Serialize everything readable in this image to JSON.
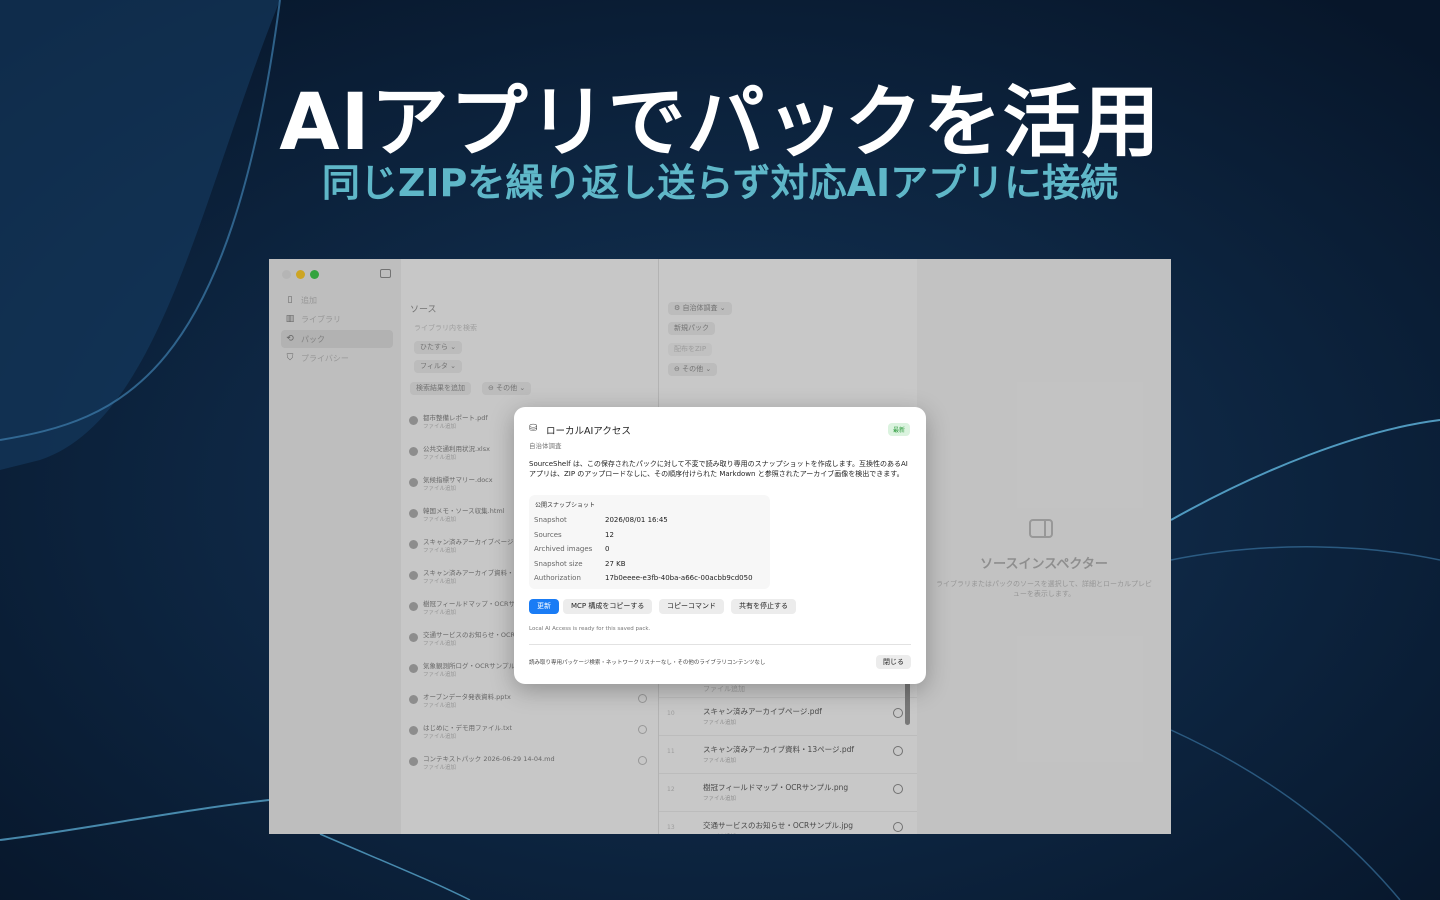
{
  "hero": {
    "title": "AIアプリでパックを活用",
    "subtitle": "同じZIPを繰り返し送らず対応AIアプリに接続"
  },
  "colors": {
    "accent": "#1a7cf5",
    "subtitle": "#5fb7c8",
    "badge": "#2a9a3a"
  },
  "sidebar": {
    "items": [
      {
        "label": "追加",
        "icon": "doc-icon"
      },
      {
        "label": "ライブラリ",
        "icon": "library-icon"
      },
      {
        "label": "パック",
        "icon": "pack-icon"
      },
      {
        "label": "プライバシー",
        "icon": "shield-icon"
      }
    ]
  },
  "sources": {
    "title": "ソース",
    "search_placeholder": "ライブラリ内を検索",
    "filter_order": "ひたすら",
    "filter": "フィルタ",
    "add_results": "検索結果を追加",
    "other": "その他",
    "files": [
      {
        "name": "都市整備レポート.pdf",
        "sub": "ファイル追加"
      },
      {
        "name": "公共交通利用状況.xlsx",
        "sub": "ファイル追加"
      },
      {
        "name": "気候指標サマリー.docx",
        "sub": "ファイル追加"
      },
      {
        "name": "韓国メモ・ソース収集.html",
        "sub": "ファイル追加"
      },
      {
        "name": "スキャン済みアーカイブページ.p",
        "sub": "ファイル追加"
      },
      {
        "name": "スキャン済みアーカイブ資料・1",
        "sub": "ファイル追加"
      },
      {
        "name": "樹冠フィールドマップ・OCRサ",
        "sub": "ファイル追加"
      },
      {
        "name": "交通サービスのお知らせ・OCR",
        "sub": "ファイル追加"
      },
      {
        "name": "気象観測所ログ・OCRサンプル",
        "sub": "ファイル追加"
      },
      {
        "name": "オープンデータ発表資料.pptx",
        "sub": "ファイル追加"
      },
      {
        "name": "はじめに・デモ用ファイル.txt",
        "sub": "ファイル追加"
      },
      {
        "name": "コンテキストパック 2026-06-29 14-04.md",
        "sub": "ファイル追加"
      }
    ]
  },
  "pack": {
    "pack_name": "自治体調査",
    "new_pack": "新規パック",
    "send_zip": "配布をZIP",
    "other": "その他",
    "items": [
      {
        "num": "10",
        "name": "スキャン済みアーカイブページ.pdf",
        "sub": "ファイル追加"
      },
      {
        "num": "11",
        "name": "スキャン済みアーカイブ資料・13ページ.pdf",
        "sub": "ファイル追加"
      },
      {
        "num": "12",
        "name": "樹冠フィールドマップ・OCRサンプル.png",
        "sub": "ファイル追加"
      },
      {
        "num": "13",
        "name": "交通サービスのお知らせ・OCRサンプル.jpg",
        "sub": "ファイル追加"
      }
    ],
    "above_row_sub": "ファイル追加"
  },
  "inspector": {
    "title": "ソースインスペクター",
    "desc": "ライブラリまたはパックのソースを選択して、詳細とローカルプレビューを表示します。"
  },
  "modal": {
    "title": "ローカルAIアクセス",
    "subtitle": "自治体調査",
    "badge": "最新",
    "description": "SourceShelf は、この保存されたパックに対して不変で読み取り専用のスナップショットを作成します。互換性のあるAIアプリは、ZIP のアップロードなしに、その順序付けられた Markdown と参照されたアーカイブ画像を検出できます。",
    "snapshot_header": "公開スナップショット",
    "rows": [
      {
        "k": "Snapshot",
        "v": "2026/08/01 16:45"
      },
      {
        "k": "Sources",
        "v": "12"
      },
      {
        "k": "Archived images",
        "v": "0"
      },
      {
        "k": "Snapshot size",
        "v": "27 KB"
      },
      {
        "k": "Authorization",
        "v": "17b0eeee-e3fb-40ba-a66c-00acbb9cd050"
      }
    ],
    "buttons": {
      "update": "更新",
      "copy_mcp": "MCP 構成をコピーする",
      "copy_cmd": "コピーコマンド",
      "stop_share": "共有を停止する"
    },
    "status": "Local AI Access is ready for this saved pack.",
    "footer": "読み取り専用パッケージ検索・ネットワークリスナーなし・その他のライブラリコンテンツなし",
    "close": "閉じる"
  }
}
